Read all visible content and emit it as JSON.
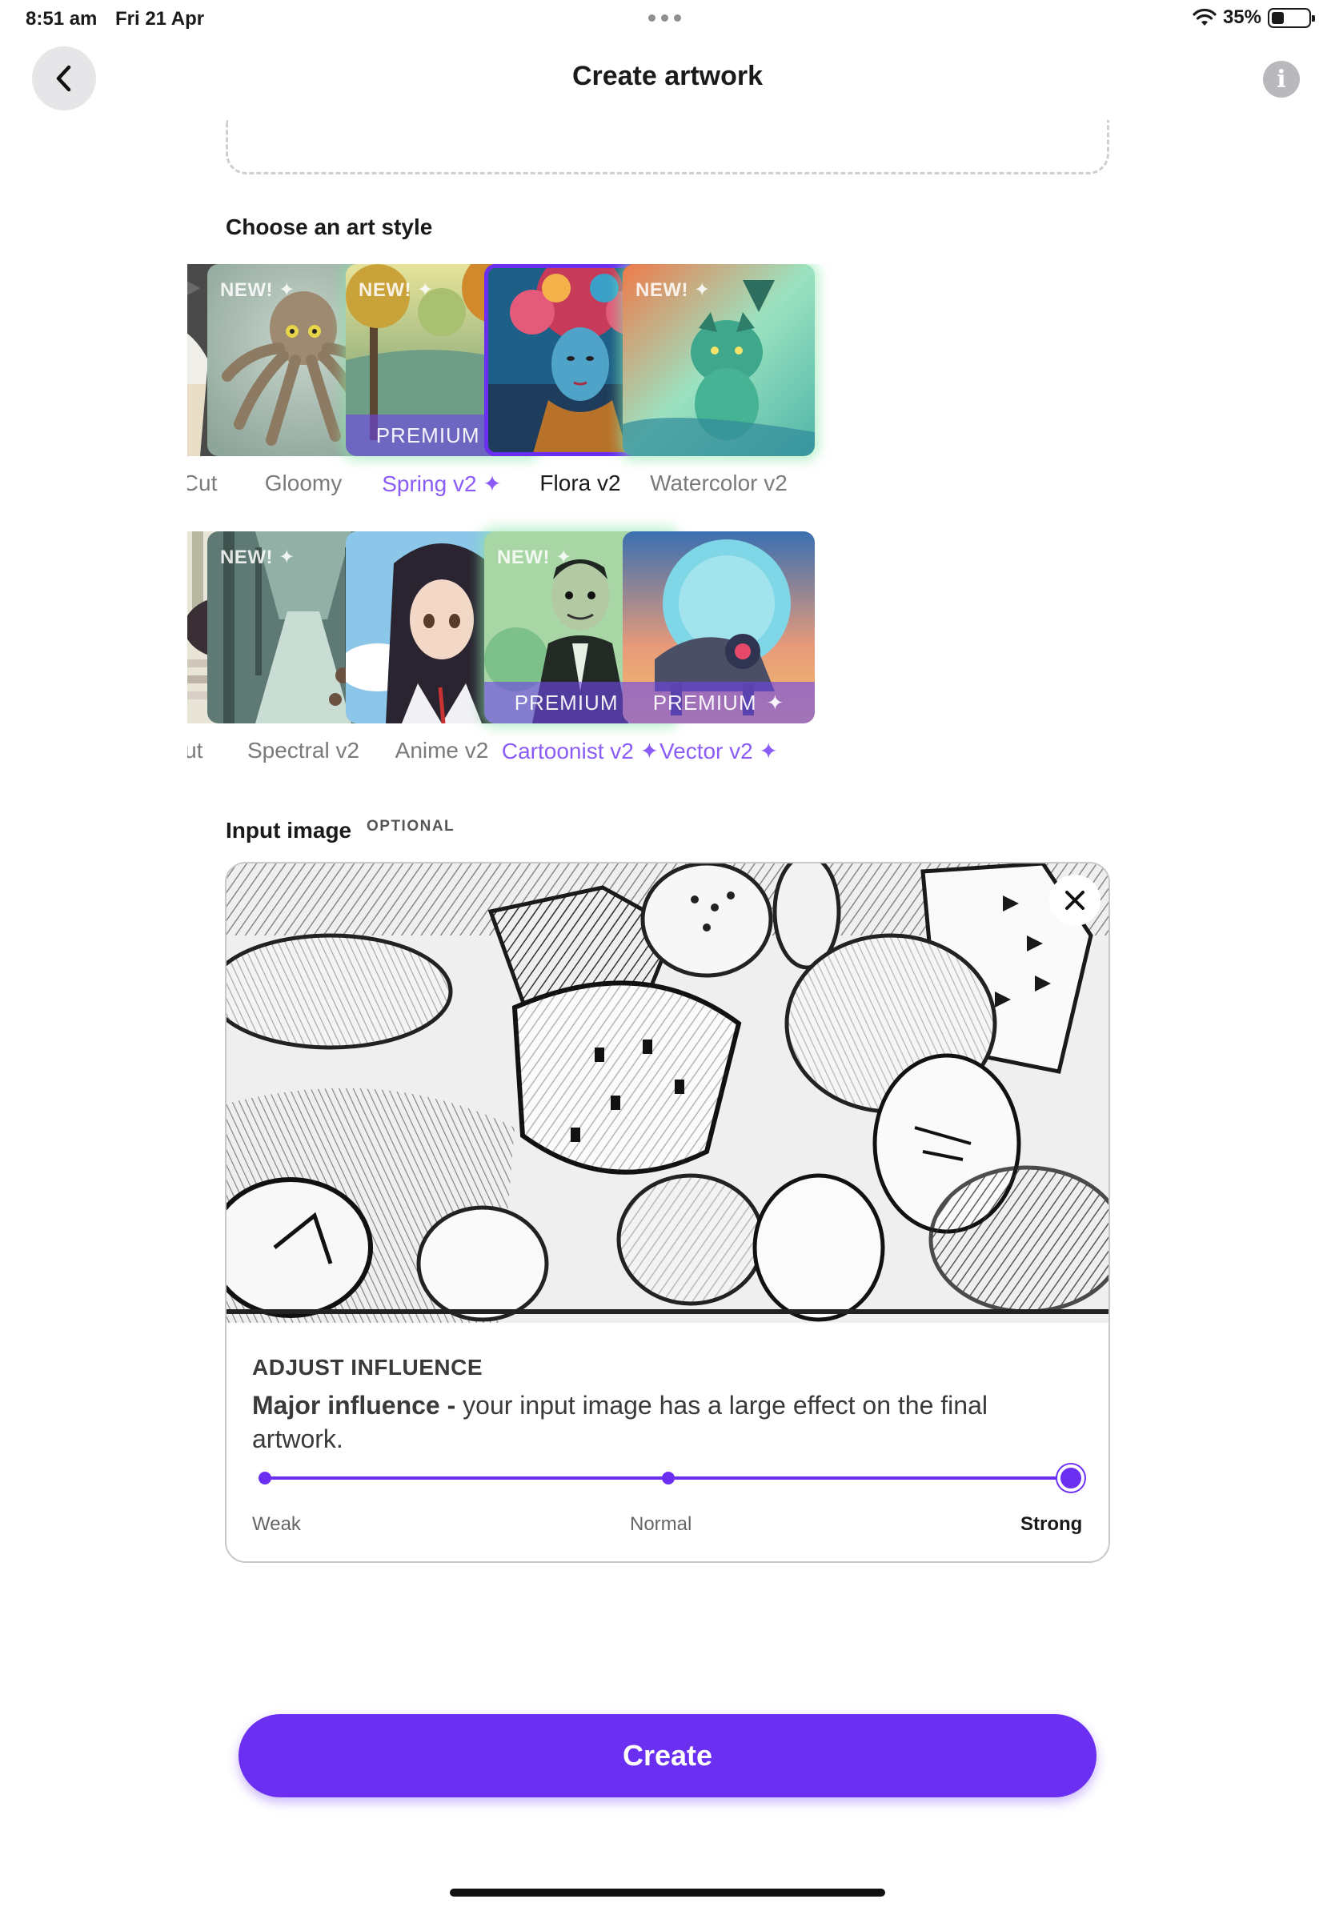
{
  "status_bar": {
    "time": "8:51 am",
    "date": "Fri 21 Apr",
    "battery": "35%",
    "battery_level": 0.35
  },
  "header": {
    "title": "Create artwork",
    "back_icon": "chevron-left-icon",
    "info_icon": "info-icon"
  },
  "art_style": {
    "title": "Choose an art style",
    "new_badge": "NEW! ✦",
    "premium_label": "PREMIUM",
    "premium_star": "✦",
    "selected": "Flora v2",
    "row1": [
      {
        "label": "Studio Cut",
        "visible_label": "ıulio Cut",
        "new": false,
        "premium": false
      },
      {
        "label": "Gloomy",
        "new": true,
        "premium": false
      },
      {
        "label": "Spring v2 ✦",
        "new": true,
        "premium": true
      },
      {
        "label": "Flora v2",
        "new": false,
        "premium": false
      },
      {
        "label": "Watercolor v2",
        "new": true,
        "premium": false
      }
    ],
    "row2": [
      {
        "label": "e Cut",
        "new": false,
        "premium": false
      },
      {
        "label": "Spectral v2",
        "new": true,
        "premium": false
      },
      {
        "label": "Anime v2",
        "new": false,
        "premium": false
      },
      {
        "label": "Cartoonist v2 ✦",
        "new": true,
        "premium": true
      },
      {
        "label": "Vector v2 ✦",
        "new": false,
        "premium": true
      }
    ]
  },
  "input_image": {
    "title": "Input image",
    "optional": "OPTIONAL",
    "remove_icon": "close-icon",
    "influence": {
      "heading": "ADJUST INFLUENCE",
      "level_name": "Major influence -",
      "description": " your input image has a large effect on the final artwork.",
      "options": [
        "Weak",
        "Normal",
        "Strong"
      ],
      "selected": "Strong",
      "selected_index": 2
    }
  },
  "create_button": "Create",
  "colors": {
    "accent": "#6b2ff2",
    "premium_text": "#8a5cf5",
    "muted_text": "#7a7a7a"
  }
}
